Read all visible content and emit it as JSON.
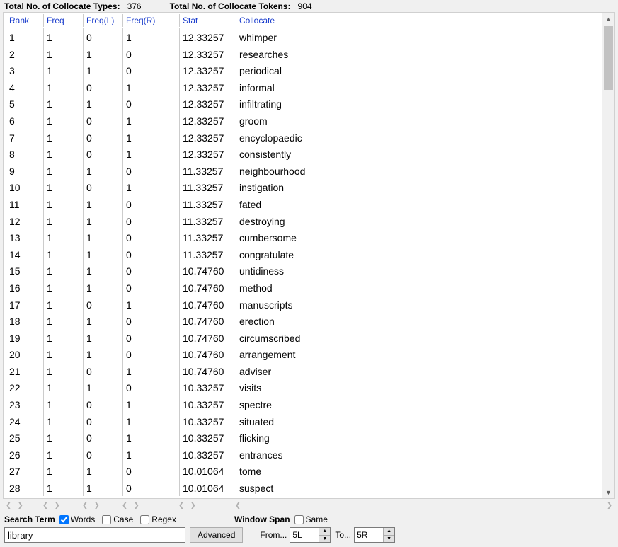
{
  "summary": {
    "types_label": "Total No. of Collocate Types:",
    "types_value": "376",
    "tokens_label": "Total No. of Collocate Tokens:",
    "tokens_value": "904"
  },
  "columns": {
    "rank": "Rank",
    "freq": "Freq",
    "freql": "Freq(L)",
    "freqr": "Freq(R)",
    "stat": "Stat",
    "coll": "Collocate"
  },
  "rows": [
    {
      "rank": "1",
      "freq": "1",
      "freql": "0",
      "freqr": "1",
      "stat": "12.33257",
      "coll": "whimper"
    },
    {
      "rank": "2",
      "freq": "1",
      "freql": "1",
      "freqr": "0",
      "stat": "12.33257",
      "coll": "researches"
    },
    {
      "rank": "3",
      "freq": "1",
      "freql": "1",
      "freqr": "0",
      "stat": "12.33257",
      "coll": "periodical"
    },
    {
      "rank": "4",
      "freq": "1",
      "freql": "0",
      "freqr": "1",
      "stat": "12.33257",
      "coll": "informal"
    },
    {
      "rank": "5",
      "freq": "1",
      "freql": "1",
      "freqr": "0",
      "stat": "12.33257",
      "coll": "infiltrating"
    },
    {
      "rank": "6",
      "freq": "1",
      "freql": "0",
      "freqr": "1",
      "stat": "12.33257",
      "coll": "groom"
    },
    {
      "rank": "7",
      "freq": "1",
      "freql": "0",
      "freqr": "1",
      "stat": "12.33257",
      "coll": "encyclopaedic"
    },
    {
      "rank": "8",
      "freq": "1",
      "freql": "0",
      "freqr": "1",
      "stat": "12.33257",
      "coll": "consistently"
    },
    {
      "rank": "9",
      "freq": "1",
      "freql": "1",
      "freqr": "0",
      "stat": "11.33257",
      "coll": "neighbourhood"
    },
    {
      "rank": "10",
      "freq": "1",
      "freql": "0",
      "freqr": "1",
      "stat": "11.33257",
      "coll": "instigation"
    },
    {
      "rank": "11",
      "freq": "1",
      "freql": "1",
      "freqr": "0",
      "stat": "11.33257",
      "coll": "fated"
    },
    {
      "rank": "12",
      "freq": "1",
      "freql": "1",
      "freqr": "0",
      "stat": "11.33257",
      "coll": "destroying"
    },
    {
      "rank": "13",
      "freq": "1",
      "freql": "1",
      "freqr": "0",
      "stat": "11.33257",
      "coll": "cumbersome"
    },
    {
      "rank": "14",
      "freq": "1",
      "freql": "1",
      "freqr": "0",
      "stat": "11.33257",
      "coll": "congratulate"
    },
    {
      "rank": "15",
      "freq": "1",
      "freql": "1",
      "freqr": "0",
      "stat": "10.74760",
      "coll": "untidiness"
    },
    {
      "rank": "16",
      "freq": "1",
      "freql": "1",
      "freqr": "0",
      "stat": "10.74760",
      "coll": "method"
    },
    {
      "rank": "17",
      "freq": "1",
      "freql": "0",
      "freqr": "1",
      "stat": "10.74760",
      "coll": "manuscripts"
    },
    {
      "rank": "18",
      "freq": "1",
      "freql": "1",
      "freqr": "0",
      "stat": "10.74760",
      "coll": "erection"
    },
    {
      "rank": "19",
      "freq": "1",
      "freql": "1",
      "freqr": "0",
      "stat": "10.74760",
      "coll": "circumscribed"
    },
    {
      "rank": "20",
      "freq": "1",
      "freql": "1",
      "freqr": "0",
      "stat": "10.74760",
      "coll": "arrangement"
    },
    {
      "rank": "21",
      "freq": "1",
      "freql": "0",
      "freqr": "1",
      "stat": "10.74760",
      "coll": "adviser"
    },
    {
      "rank": "22",
      "freq": "1",
      "freql": "1",
      "freqr": "0",
      "stat": "10.33257",
      "coll": "visits"
    },
    {
      "rank": "23",
      "freq": "1",
      "freql": "0",
      "freqr": "1",
      "stat": "10.33257",
      "coll": "spectre"
    },
    {
      "rank": "24",
      "freq": "1",
      "freql": "0",
      "freqr": "1",
      "stat": "10.33257",
      "coll": "situated"
    },
    {
      "rank": "25",
      "freq": "1",
      "freql": "0",
      "freqr": "1",
      "stat": "10.33257",
      "coll": "flicking"
    },
    {
      "rank": "26",
      "freq": "1",
      "freql": "0",
      "freqr": "1",
      "stat": "10.33257",
      "coll": "entrances"
    },
    {
      "rank": "27",
      "freq": "1",
      "freql": "1",
      "freqr": "0",
      "stat": "10.01064",
      "coll": "tome"
    },
    {
      "rank": "28",
      "freq": "1",
      "freql": "1",
      "freqr": "0",
      "stat": "10.01064",
      "coll": "suspect"
    }
  ],
  "search": {
    "term_label": "Search Term",
    "words_label": "Words",
    "case_label": "Case",
    "regex_label": "Regex",
    "value": "library",
    "advanced_label": "Advanced"
  },
  "window": {
    "span_label": "Window Span",
    "same_label": "Same",
    "from_label": "From...",
    "from_value": "5L",
    "to_label": "To...",
    "to_value": "5R"
  }
}
